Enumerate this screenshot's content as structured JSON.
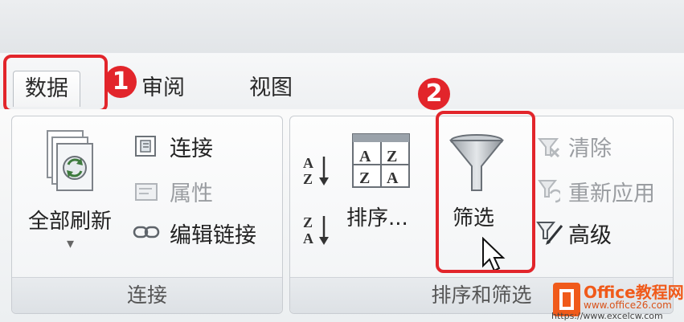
{
  "tabs": [
    {
      "label": "数据",
      "active": true
    },
    {
      "label": "审阅",
      "active": false
    },
    {
      "label": "视图",
      "active": false
    }
  ],
  "callouts": [
    {
      "number": "1",
      "target": "数据"
    },
    {
      "number": "2",
      "target": "筛选"
    }
  ],
  "groups": {
    "connections": {
      "label": "连接",
      "refresh_all": "全部刷新",
      "refresh_dropdown": "▾",
      "connections_btn": "连接",
      "properties_btn": "属性",
      "edit_links_btn": "编辑链接"
    },
    "sort_filter": {
      "label": "排序和筛选",
      "sort_az_btn": "A→Z",
      "sort_za_btn": "Z→A",
      "sort_btn": "排序...",
      "filter_btn": "筛选",
      "clear_btn": "清除",
      "reapply_btn": "重新应用",
      "advanced_btn": "高级"
    }
  },
  "watermark": {
    "brand": "Office教程网",
    "url1": "www.office26.com",
    "url2": "https://www.excelcw.com"
  },
  "colors": {
    "callout_red": "#e2252b",
    "logo_orange": "#f05a1a"
  }
}
